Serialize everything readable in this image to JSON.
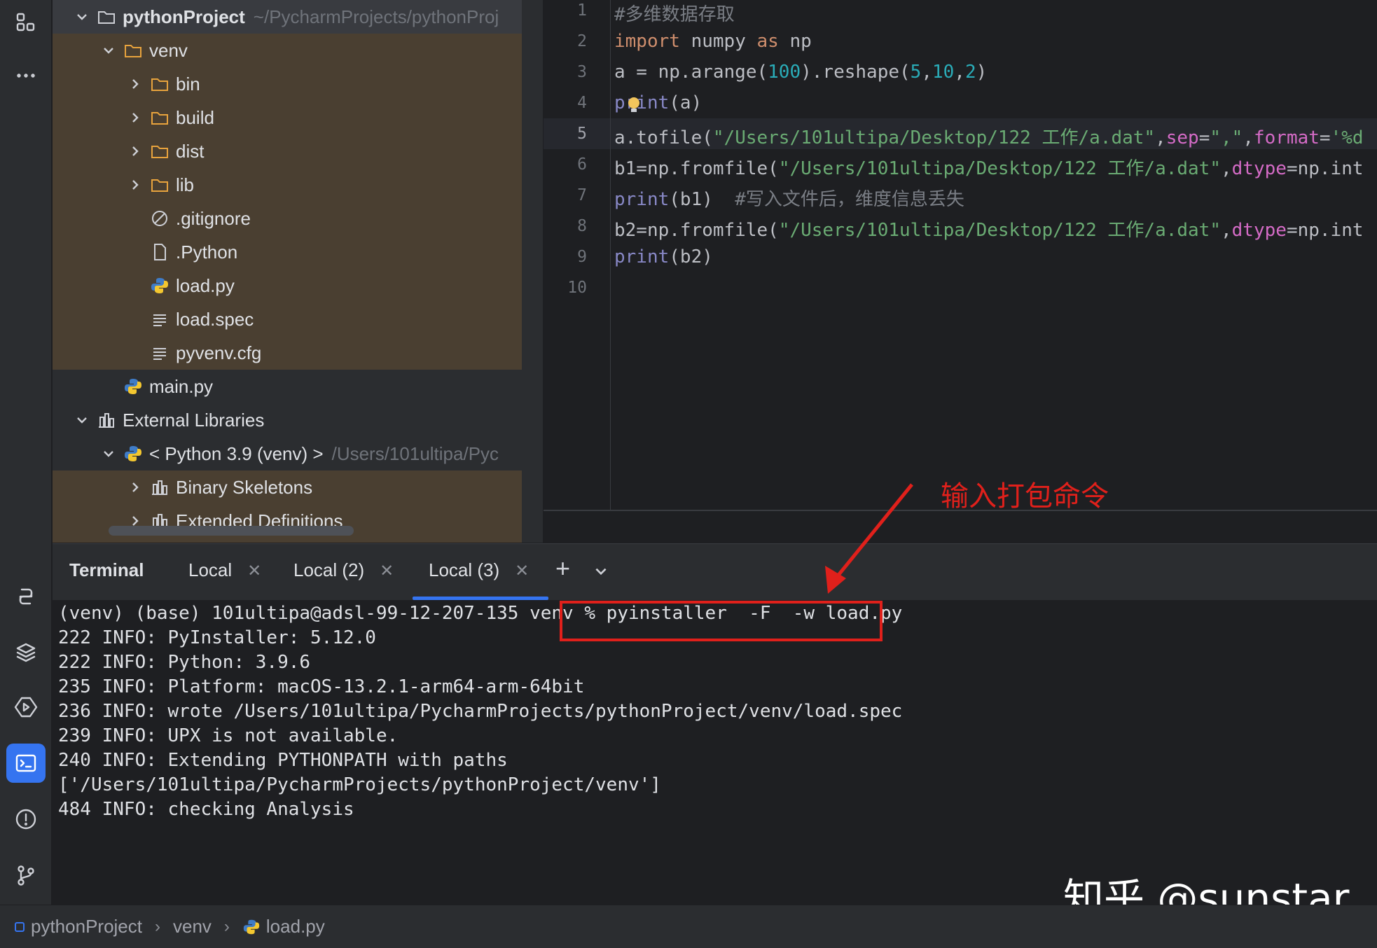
{
  "project_tree": {
    "root": {
      "name": "pythonProject",
      "path": "~/PycharmProjects/pythonProj"
    },
    "items": [
      {
        "name": "venv"
      },
      {
        "name": "bin"
      },
      {
        "name": "build"
      },
      {
        "name": "dist"
      },
      {
        "name": "lib"
      },
      {
        "name": ".gitignore"
      },
      {
        "name": ".Python"
      },
      {
        "name": "load.py"
      },
      {
        "name": "load.spec"
      },
      {
        "name": "pyvenv.cfg"
      },
      {
        "name": "main.py"
      },
      {
        "name": "External Libraries"
      },
      {
        "name": "< Python 3.9 (venv) >",
        "path": "/Users/101ultipa/Pyc"
      },
      {
        "name": "Binary Skeletons"
      },
      {
        "name": "Extended Definitions"
      }
    ]
  },
  "editor": {
    "line_numbers": [
      "1",
      "2",
      "3",
      "4",
      "5",
      "6",
      "7",
      "8",
      "9",
      "10"
    ],
    "current_line": "5",
    "lines": [
      [
        {
          "t": "#多维数据存取",
          "c": "cm"
        }
      ],
      [
        {
          "t": "import",
          "c": "kw"
        },
        {
          "t": " numpy ",
          "c": ""
        },
        {
          "t": "as",
          "c": "kw"
        },
        {
          "t": " np",
          "c": ""
        }
      ],
      [
        {
          "t": "a = np.arange(",
          "c": ""
        },
        {
          "t": "100",
          "c": "num"
        },
        {
          "t": ").reshape(",
          "c": ""
        },
        {
          "t": "5",
          "c": "num"
        },
        {
          "t": ",",
          "c": ""
        },
        {
          "t": "10",
          "c": "num"
        },
        {
          "t": ",",
          "c": ""
        },
        {
          "t": "2",
          "c": "num"
        },
        {
          "t": ")",
          "c": ""
        }
      ],
      [
        {
          "t": "print",
          "c": "bi"
        },
        {
          "t": "(a)",
          "c": ""
        }
      ],
      [
        {
          "t": "a.tofile(",
          "c": ""
        },
        {
          "t": "\"/Users/101ultipa/Desktop/122 工作/a.dat\"",
          "c": "str"
        },
        {
          "t": ",",
          "c": ""
        },
        {
          "t": "sep",
          "c": "param"
        },
        {
          "t": "=",
          "c": ""
        },
        {
          "t": "\",\"",
          "c": "str"
        },
        {
          "t": ",",
          "c": ""
        },
        {
          "t": "format",
          "c": "param"
        },
        {
          "t": "=",
          "c": ""
        },
        {
          "t": "'%d",
          "c": "str"
        }
      ],
      [
        {
          "t": "b1=np.fromfile(",
          "c": ""
        },
        {
          "t": "\"/Users/101ultipa/Desktop/122 工作/a.dat\"",
          "c": "str"
        },
        {
          "t": ",",
          "c": ""
        },
        {
          "t": "dtype",
          "c": "param"
        },
        {
          "t": "=np.int",
          "c": ""
        }
      ],
      [
        {
          "t": "print",
          "c": "bi"
        },
        {
          "t": "(b1)  ",
          "c": ""
        },
        {
          "t": "#写入文件后，维度信息丢失",
          "c": "cm"
        }
      ],
      [
        {
          "t": "b2=np.fromfile(",
          "c": ""
        },
        {
          "t": "\"/Users/101ultipa/Desktop/122 工作/a.dat\"",
          "c": "str"
        },
        {
          "t": ",",
          "c": ""
        },
        {
          "t": "dtype",
          "c": "param"
        },
        {
          "t": "=np.int",
          "c": ""
        }
      ],
      [
        {
          "t": "print",
          "c": "bi"
        },
        {
          "t": "(b2)",
          "c": ""
        }
      ],
      []
    ]
  },
  "terminal": {
    "tabs": {
      "title": "Terminal",
      "tab1": "Local",
      "tab2": "Local (2)",
      "tab3": "Local (3)"
    },
    "prompt": "(venv) (base) 101ultipa@adsl-99-12-207-135 venv % ",
    "command": "pyinstaller  -F  -w load.py",
    "output": [
      "222 INFO: PyInstaller: 5.12.0",
      "222 INFO: Python: 3.9.6",
      "235 INFO: Platform: macOS-13.2.1-arm64-arm-64bit",
      "236 INFO: wrote /Users/101ultipa/PycharmProjects/pythonProject/venv/load.spec",
      "239 INFO: UPX is not available.",
      "240 INFO: Extending PYTHONPATH with paths",
      "['/Users/101ultipa/PycharmProjects/pythonProject/venv']",
      "484 INFO: checking Analysis"
    ]
  },
  "annotation": {
    "text": "输入打包命令",
    "color": "#e0201b"
  },
  "watermark": "知乎 @sunstar",
  "breadcrumb": {
    "project": "pythonProject",
    "folder": "venv",
    "file": "load.py"
  },
  "colors": {
    "accent": "#3574f0",
    "folder_band": "#4a3f31"
  }
}
